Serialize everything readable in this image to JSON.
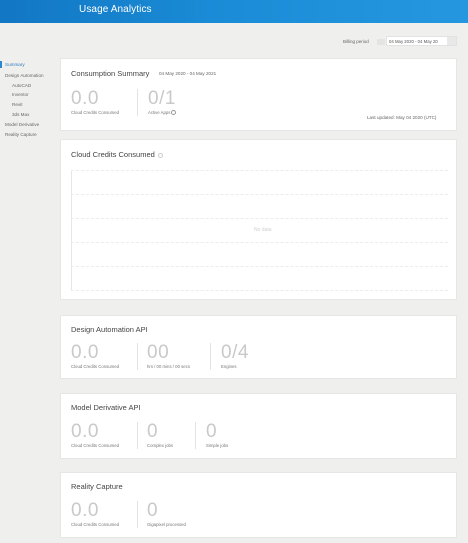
{
  "header": {
    "title": "Usage Analytics"
  },
  "billing": {
    "label": "Billing period",
    "range": "04 May 2020 - 04 May 20"
  },
  "sidebar": {
    "items": [
      {
        "label": "Summary",
        "active": true
      },
      {
        "label": "Design Automation"
      },
      {
        "label": "AutoCAD",
        "sub": true
      },
      {
        "label": "Inventor",
        "sub": true
      },
      {
        "label": "Revit",
        "sub": true
      },
      {
        "label": "3ds Max",
        "sub": true
      },
      {
        "label": "Model Derivative"
      },
      {
        "label": "Reality Capture"
      }
    ]
  },
  "consumption": {
    "title": "Consumption Summary",
    "date_range": "04 May 2020 - 04 May 2021",
    "credits_value": "0.0",
    "credits_label": "Cloud Credits Consumed",
    "apps_value": "0/1",
    "apps_label": "Active Apps",
    "last_updated": "Last updated: May 04 2020 (UTC)"
  },
  "credits_chart": {
    "title": "Cloud Credits Consumed",
    "empty_text": "No data"
  },
  "design_automation": {
    "title": "Design Automation API",
    "credits_value": "0.0",
    "credits_label": "Cloud Credits Consumed",
    "time_value": "00",
    "time_label": "hrs / 00 mins / 00 secs",
    "engines_value": "0/4",
    "engines_label": "Engines"
  },
  "model_derivative": {
    "title": "Model Derivative API",
    "credits_value": "0.0",
    "credits_label": "Cloud Credits Consumed",
    "complex_value": "0",
    "complex_label": "Complex jobs",
    "simple_value": "0",
    "simple_label": "Simple jobs"
  },
  "reality_capture": {
    "title": "Reality Capture",
    "credits_value": "0.0",
    "credits_label": "Cloud Credits Consumed",
    "gp_value": "0",
    "gp_label": "Gigapixel processed"
  },
  "colors": {
    "header": "#1a8bd6",
    "accent": "#2d87d0",
    "muted_value": "#c9c9c9"
  }
}
